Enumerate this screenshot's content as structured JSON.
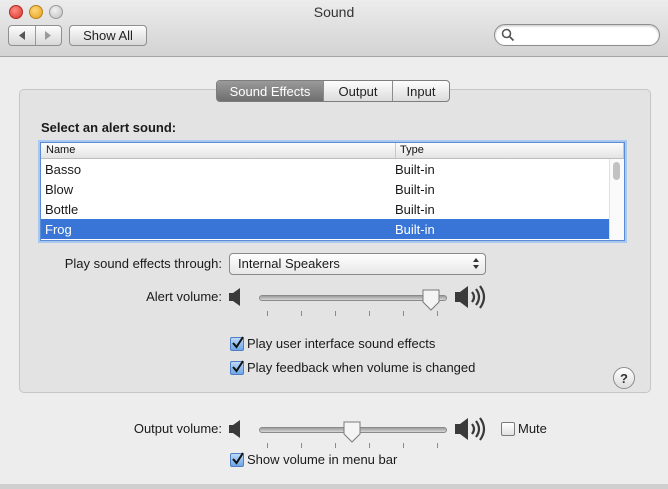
{
  "window": {
    "title": "Sound"
  },
  "toolbar": {
    "back_icon": "chevron-left-icon",
    "forward_icon": "chevron-right-icon",
    "show_all_label": "Show All",
    "search_value": "",
    "search_placeholder": ""
  },
  "tabs": [
    {
      "label": "Sound Effects",
      "active": true
    },
    {
      "label": "Output",
      "active": false
    },
    {
      "label": "Input",
      "active": false
    }
  ],
  "alerts": {
    "heading": "Select an alert sound:",
    "columns": [
      "Name",
      "Type"
    ],
    "rows": [
      {
        "name": "Basso",
        "type": "Built-in",
        "selected": false
      },
      {
        "name": "Blow",
        "type": "Built-in",
        "selected": false
      },
      {
        "name": "Bottle",
        "type": "Built-in",
        "selected": false
      },
      {
        "name": "Frog",
        "type": "Built-in",
        "selected": true
      }
    ]
  },
  "play_through": {
    "label": "Play sound effects through:",
    "selected": "Internal Speakers"
  },
  "alert_volume": {
    "label": "Alert volume:",
    "level": 0.97
  },
  "checkboxes": {
    "ui_effects": {
      "label": "Play user interface sound effects",
      "checked": true
    },
    "feedback": {
      "label": "Play feedback when volume is changed",
      "checked": true
    }
  },
  "output_volume": {
    "label": "Output volume:",
    "level": 0.5
  },
  "mute": {
    "label": "Mute",
    "checked": false
  },
  "show_volume": {
    "label": "Show volume in menu bar",
    "checked": true
  },
  "help": {
    "label": "?"
  },
  "colors": {
    "selection": "#3875d7",
    "checkbox_on": "#6ea5e6"
  }
}
